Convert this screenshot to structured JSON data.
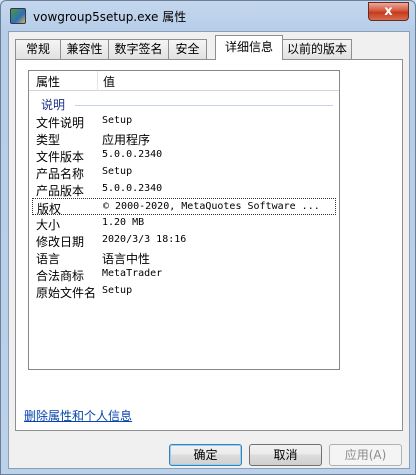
{
  "window": {
    "title": "vowgroup5setup.exe 属性",
    "close_glyph": "x"
  },
  "tabs": [
    {
      "label": "常规"
    },
    {
      "label": "兼容性"
    },
    {
      "label": "数字签名"
    },
    {
      "label": "安全"
    },
    {
      "label": "详细信息"
    },
    {
      "label": "以前的版本"
    }
  ],
  "active_tab": "详细信息",
  "listview": {
    "columns": {
      "property": "属性",
      "value": "值"
    },
    "group": "说明",
    "rows": [
      {
        "property": "文件说明",
        "value": "Setup"
      },
      {
        "property": "类型",
        "value": "应用程序"
      },
      {
        "property": "文件版本",
        "value": "5.0.0.2340"
      },
      {
        "property": "产品名称",
        "value": "Setup"
      },
      {
        "property": "产品版本",
        "value": "5.0.0.2340"
      },
      {
        "property": "版权",
        "value": "© 2000-2020, MetaQuotes Software ..."
      },
      {
        "property": "大小",
        "value": "1.20 MB"
      },
      {
        "property": "修改日期",
        "value": "2020/3/3 18:16"
      },
      {
        "property": "语言",
        "value": "语言中性"
      },
      {
        "property": "合法商标",
        "value": "MetaTrader"
      },
      {
        "property": "原始文件名",
        "value": "Setup"
      }
    ]
  },
  "remove_link": "删除属性和个人信息",
  "buttons": {
    "ok": "确定",
    "cancel": "取消",
    "apply": "应用(A)"
  }
}
